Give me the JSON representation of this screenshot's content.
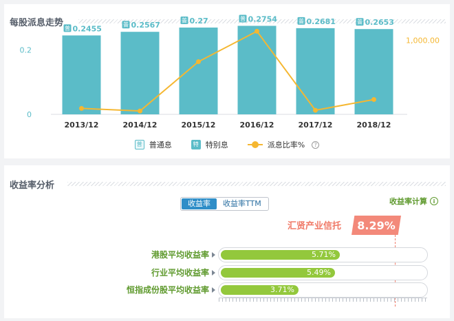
{
  "dividend_section": {
    "title": "每股派息走势",
    "legend": {
      "regular_icon": "普",
      "regular": "普通息",
      "special_icon": "特",
      "special": "特别息",
      "payout": "派息比率%",
      "help_icon": "?"
    }
  },
  "chart_data": {
    "type": "bar",
    "title": "",
    "xlabel": "",
    "ylabel": "",
    "categories": [
      "2013/12",
      "2014/12",
      "2015/12",
      "2016/12",
      "2017/12",
      "2018/12"
    ],
    "series": [
      {
        "name": "普通息",
        "type": "bar",
        "axis": "left",
        "values": [
          0.2455,
          0.2567,
          0.27,
          0.2754,
          0.2681,
          0.2653
        ],
        "labels": [
          "0.2455",
          "0.2567",
          "0.27",
          "0.2754",
          "0.2681",
          "0.2653"
        ],
        "label_icon": "普"
      },
      {
        "name": "派息比率%",
        "type": "line",
        "axis": "right",
        "values": [
          80,
          45,
          710,
          1120,
          55,
          200
        ]
      }
    ],
    "y_left": {
      "ticks": [
        0,
        0.2
      ],
      "tick_labels": [
        "0",
        "0.2"
      ],
      "ylim": [
        0,
        0.3
      ]
    },
    "y_right": {
      "ticks": [
        1000
      ],
      "tick_labels": [
        "1,000.00"
      ],
      "ylim": [
        0,
        1300
      ]
    },
    "grid": false,
    "legend_position": "bottom-center",
    "colors": {
      "bar": "#5bbcc8",
      "line": "#f5b731"
    }
  },
  "yield_section": {
    "title": "收益率分析",
    "tabs": [
      {
        "label": "收益率",
        "active": true
      },
      {
        "label": "收益率TTM",
        "active": false
      }
    ],
    "calc_label": "收益率计算",
    "info_icon": "i",
    "company": {
      "name": "汇贤产业信托",
      "value": "8.29%"
    },
    "rows": [
      {
        "label": "港股平均收益率",
        "value": "5.71%",
        "fraction": 0.583
      },
      {
        "label": "行业平均收益率",
        "value": "5.49%",
        "fraction": 0.56
      },
      {
        "label": "恒指成份股平均收益率",
        "value": "3.71%",
        "fraction": 0.38
      }
    ],
    "colors": {
      "bar": "#93c83c",
      "label": "#5f9a2e",
      "company": "#f3897a"
    }
  }
}
